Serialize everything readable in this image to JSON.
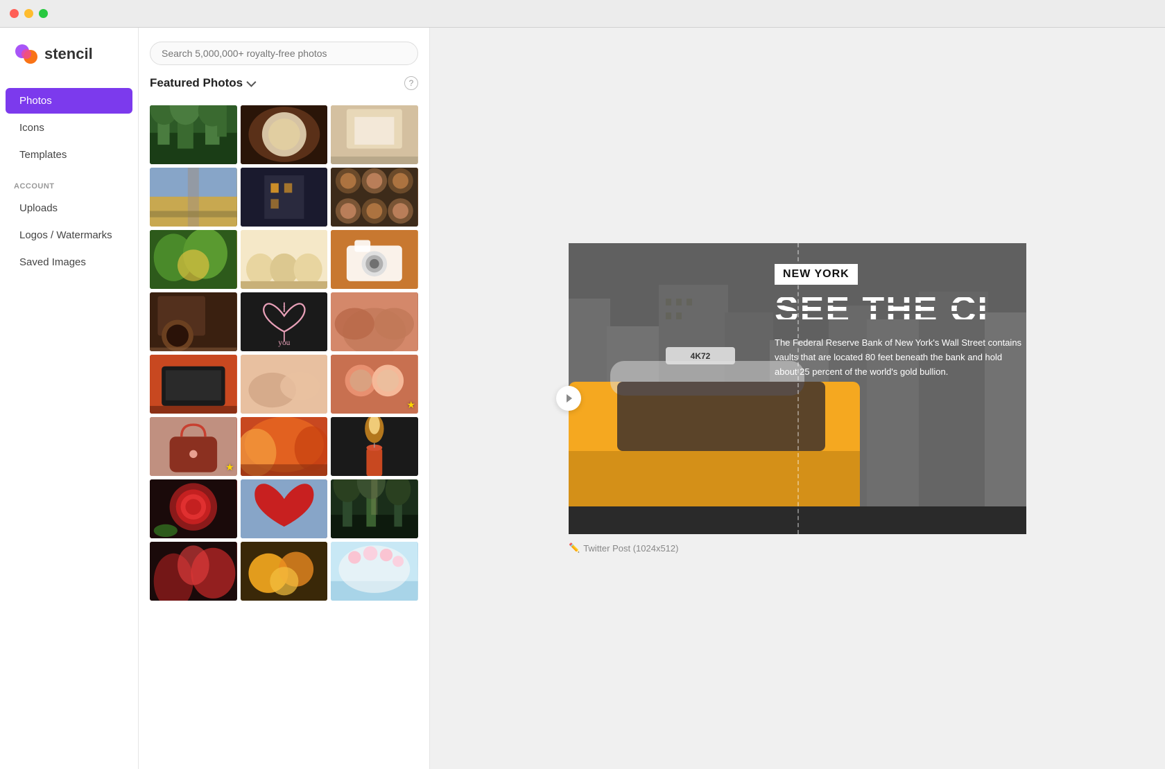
{
  "titleBar": {
    "trafficLights": [
      "close",
      "minimize",
      "maximize"
    ]
  },
  "sidebar": {
    "logo": {
      "text": "stencil"
    },
    "navItems": [
      {
        "id": "photos",
        "label": "Photos",
        "active": true
      },
      {
        "id": "icons",
        "label": "Icons",
        "active": false
      },
      {
        "id": "templates",
        "label": "Templates",
        "active": false
      }
    ],
    "accountSection": {
      "label": "ACCOUNT",
      "items": [
        {
          "id": "uploads",
          "label": "Uploads"
        },
        {
          "id": "logos",
          "label": "Logos / Watermarks"
        },
        {
          "id": "saved",
          "label": "Saved Images"
        }
      ]
    }
  },
  "photoPanel": {
    "searchPlaceholder": "Search 5,000,000+ royalty-free photos",
    "featuredTitle": "Featured Photos",
    "helpIcon": "?",
    "photos": [
      [
        "forest",
        "baking",
        "kitchen"
      ],
      [
        "road",
        "night",
        "muffins"
      ],
      [
        "plants",
        "dough",
        "camera"
      ],
      [
        "coffee",
        "heart-art",
        "hands"
      ],
      [
        "laptop",
        "baby-hands",
        "kids"
      ],
      [
        "bag",
        "autumn",
        "candle"
      ],
      [
        "rose",
        "heart-red",
        "forest2"
      ],
      [
        "exotic",
        "flowers",
        "cherry"
      ]
    ]
  },
  "canvas": {
    "badge": "NEW YORK",
    "headline": "SEE THE CI",
    "description": "The Federal Reserve Bank of New York's Wall Street contains vaults that are located 80 feet beneath the bank and hold about 25 percent of the world's gold bullion.",
    "label": "Twitter Post (1024x512)",
    "taxiNumber": "4K72"
  }
}
